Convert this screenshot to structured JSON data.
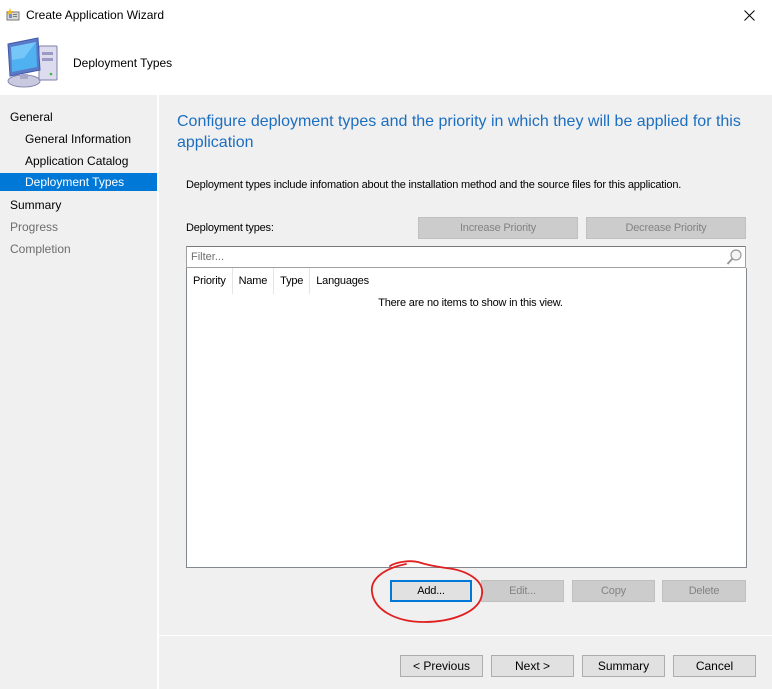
{
  "window": {
    "title": "Create Application Wizard",
    "close_icon": "close-icon"
  },
  "header": {
    "title": "Deployment Types",
    "icon": "computer-icon"
  },
  "sidebar": {
    "items": [
      {
        "label": "General",
        "level": 0,
        "state": "normal"
      },
      {
        "label": "General Information",
        "level": 1,
        "state": "normal"
      },
      {
        "label": "Application Catalog",
        "level": 1,
        "state": "normal"
      },
      {
        "label": "Deployment Types",
        "level": 1,
        "state": "active"
      },
      {
        "label": "Summary",
        "level": 0,
        "state": "normal"
      },
      {
        "label": "Progress",
        "level": 0,
        "state": "disabled"
      },
      {
        "label": "Completion",
        "level": 0,
        "state": "disabled"
      }
    ]
  },
  "main": {
    "heading": "Configure deployment types and the priority in which they will be applied for this application",
    "description": "Deployment types include infomation about the installation method and the source files for this application.",
    "deployment_types_label": "Deployment types:",
    "increase_priority": "Increase Priority",
    "decrease_priority": "Decrease Priority",
    "filter": {
      "value": "",
      "placeholder": "Filter...",
      "icon": "search-icon"
    },
    "list": {
      "columns": [
        "Priority",
        "Name",
        "Type",
        "Languages"
      ],
      "rows": [],
      "empty_message": "There are no items to show in this view."
    },
    "actions": {
      "add": "Add...",
      "edit": "Edit...",
      "copy": "Copy",
      "delete": "Delete"
    }
  },
  "footer": {
    "previous": "< Previous",
    "next": "Next >",
    "summary": "Summary",
    "cancel": "Cancel"
  },
  "colors": {
    "accent": "#0078d7",
    "heading": "#1c6ec1",
    "annotation": "#e02020"
  }
}
